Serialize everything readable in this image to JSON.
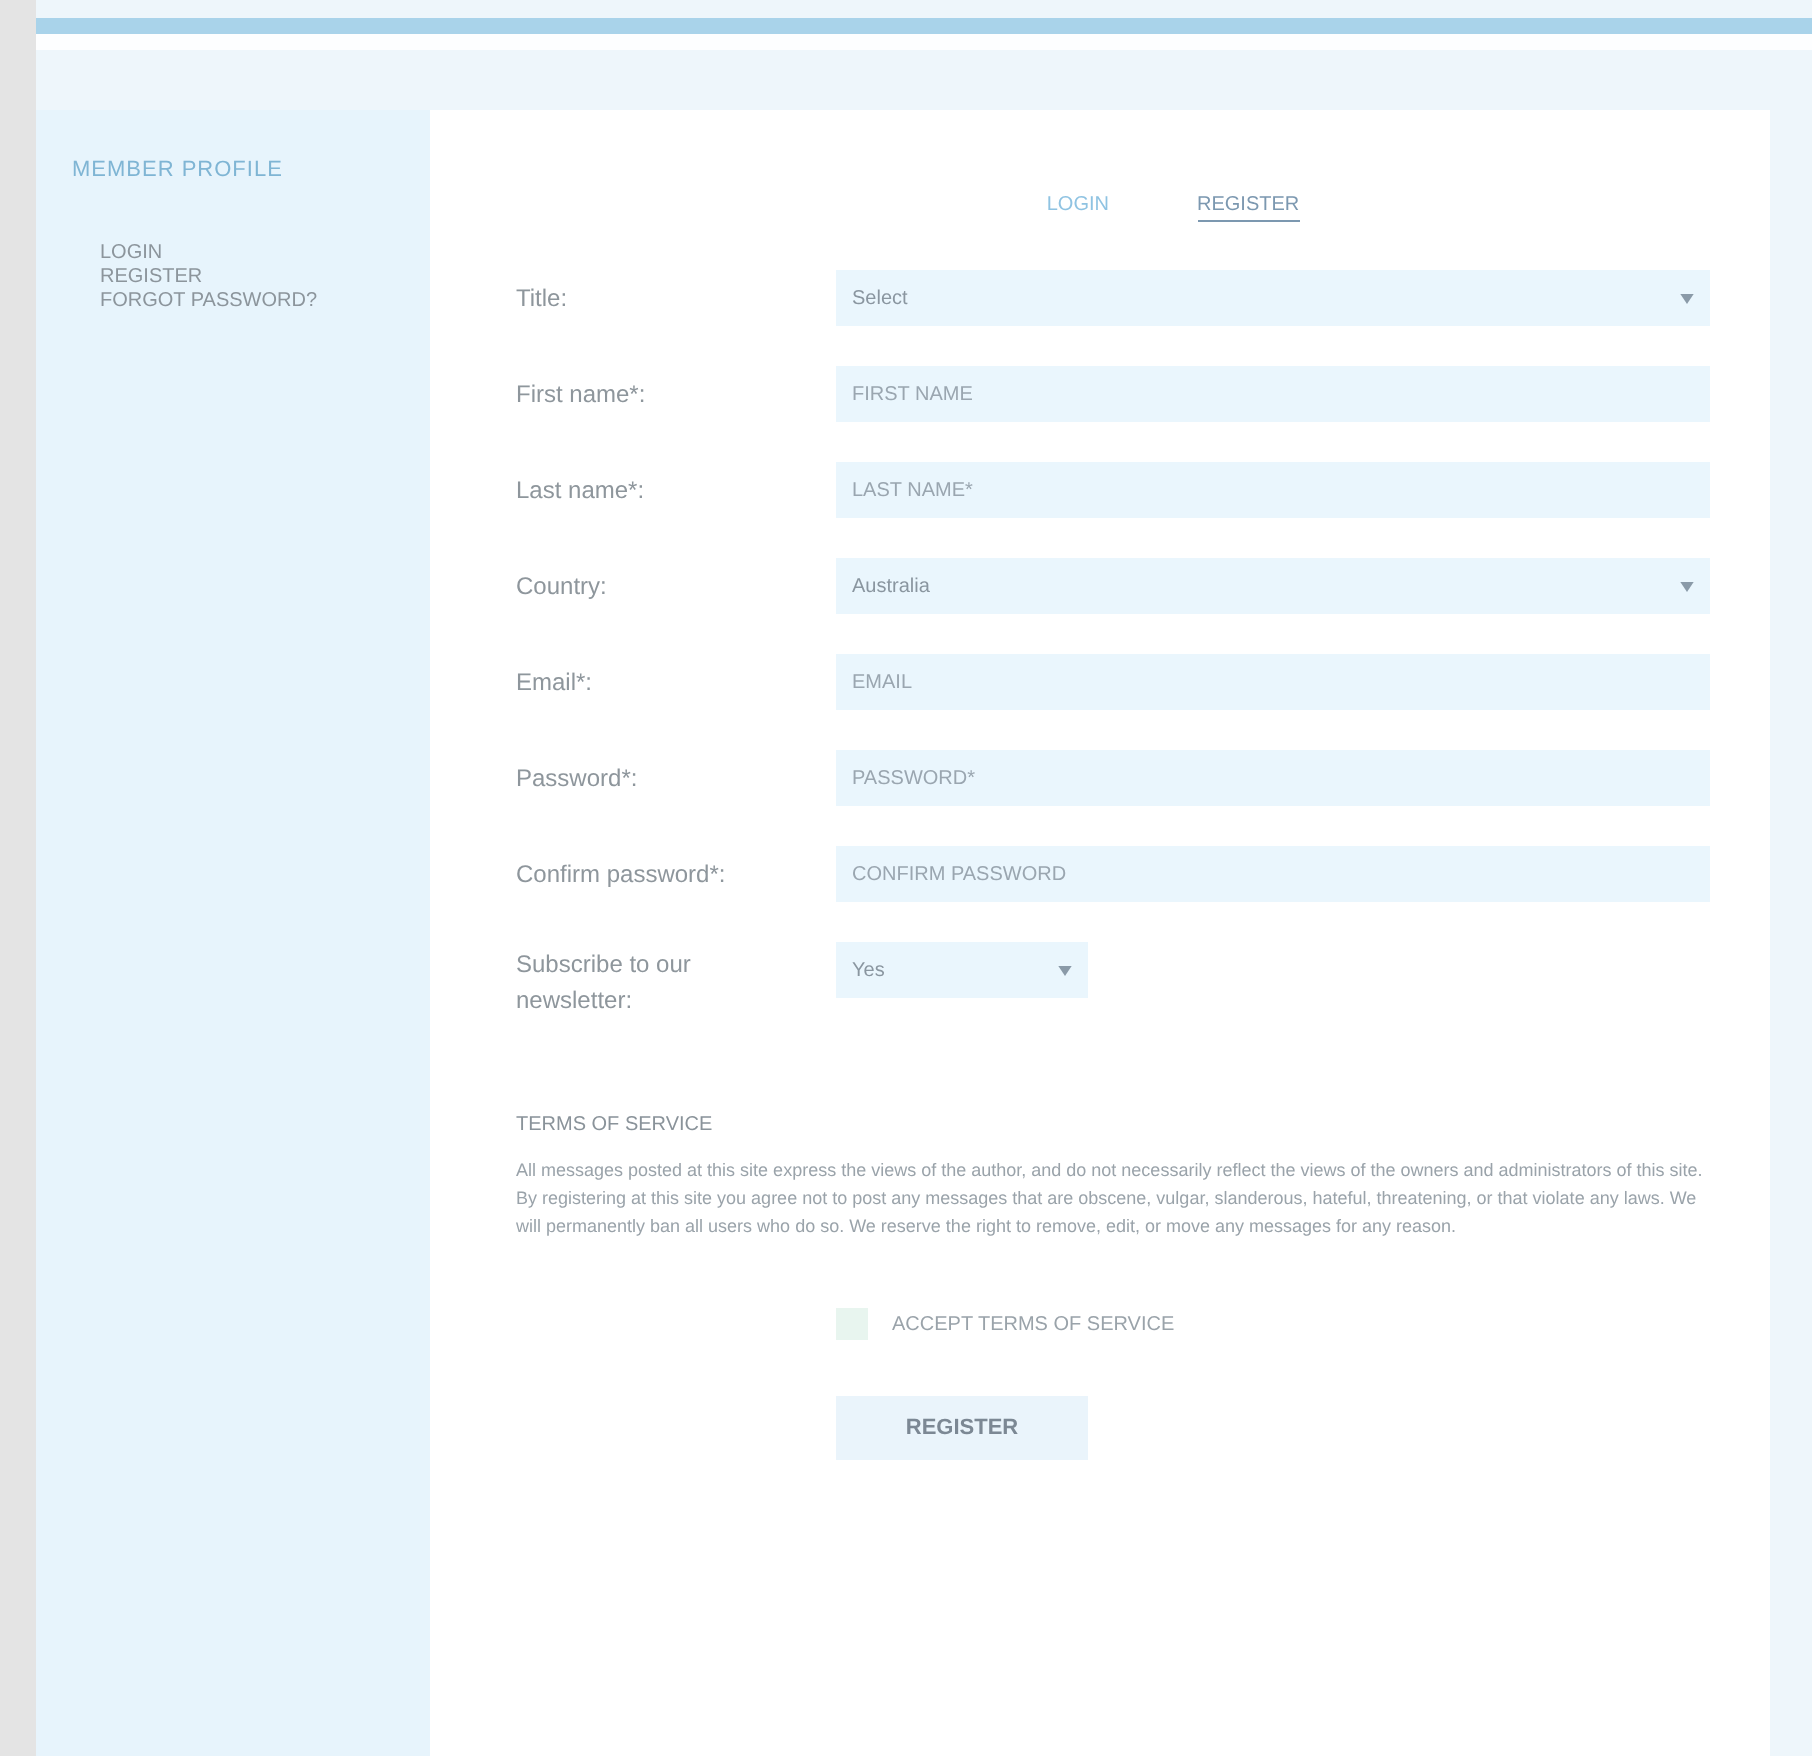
{
  "sidebar": {
    "title": "MEMBER PROFILE",
    "links": [
      {
        "label": "LOGIN"
      },
      {
        "label": "REGISTER"
      },
      {
        "label": "FORGOT PASSWORD?"
      }
    ]
  },
  "tabs": [
    {
      "label": "LOGIN",
      "selected": false
    },
    {
      "label": "REGISTER",
      "selected": true
    }
  ],
  "fields": [
    {
      "label": "Title:",
      "kind": "select",
      "value": "Select"
    },
    {
      "label": "First name*:",
      "kind": "text",
      "placeholder": "FIRST NAME"
    },
    {
      "label": "Last name*:",
      "kind": "text",
      "placeholder": "LAST NAME*"
    },
    {
      "label": "Country:",
      "kind": "select",
      "value": "Australia"
    },
    {
      "label": "Email*:",
      "kind": "text",
      "placeholder": "EMAIL"
    },
    {
      "label": "Password*:",
      "kind": "text",
      "placeholder": "PASSWORD*"
    },
    {
      "label": "Confirm password*:",
      "kind": "text",
      "placeholder": "CONFIRM PASSWORD"
    },
    {
      "label": "Subscribe to our newsletter:",
      "kind": "small-select",
      "value": "Yes"
    }
  ],
  "terms": {
    "heading": "TERMS OF SERVICE",
    "text": "All messages posted at this site express the views of the author, and do not necessarily reflect the views of the owners and administrators of this site. By registering at this site you agree not to post any messages that are obscene, vulgar, slanderous, hateful, threatening, or that violate any laws. We will permanently ban all users who do so. We reserve the right to remove, edit, or move any messages for any reason."
  },
  "accept": {
    "label": "ACCEPT TERMS OF SERVICE",
    "checked": false
  },
  "submit": {
    "label": "REGISTER"
  }
}
